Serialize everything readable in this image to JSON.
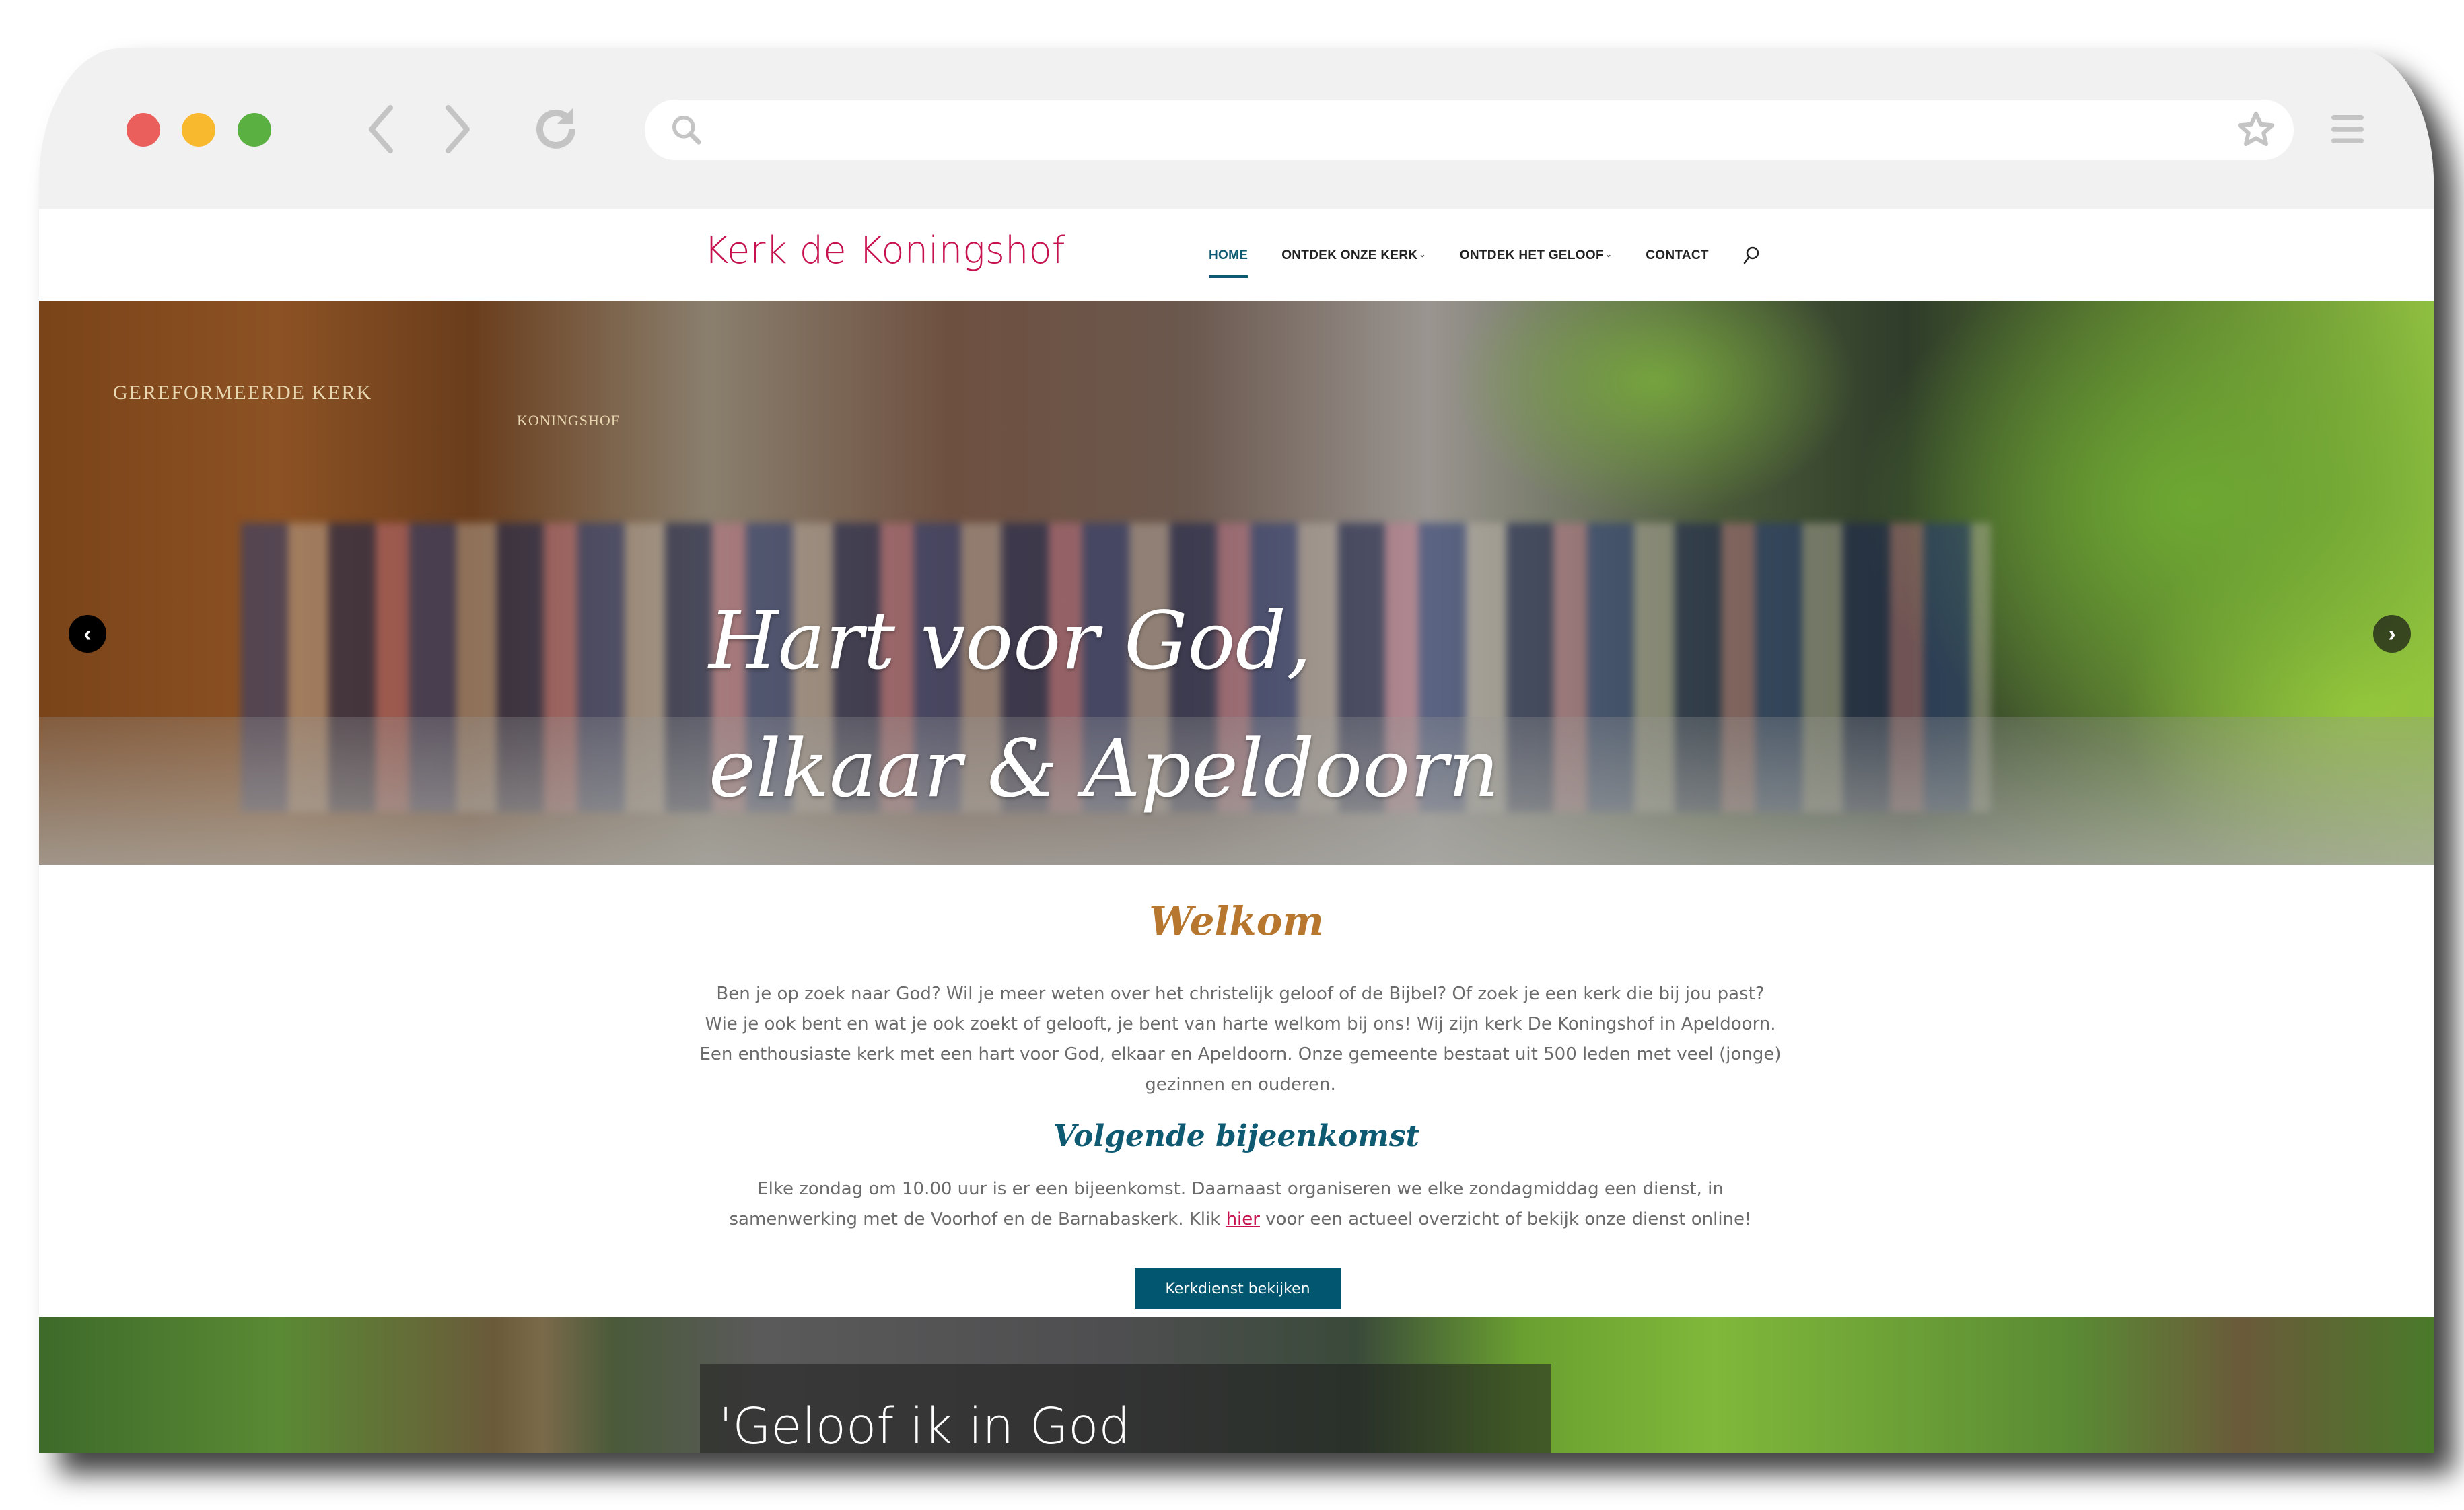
{
  "browser": {
    "address_value": "",
    "icons": [
      "close-dot",
      "minimize-dot",
      "maximize-dot",
      "back-icon",
      "forward-icon",
      "reload-icon",
      "search-icon",
      "star-icon",
      "menu-icon"
    ]
  },
  "site": {
    "logo": "Kerk de Koningshof",
    "brand_color": "#c8124f",
    "accent_color": "#0e5a73",
    "nav": [
      {
        "label": "HOME",
        "active": true,
        "dropdown": false
      },
      {
        "label": "ONTDEK ONZE KERK",
        "active": false,
        "dropdown": true
      },
      {
        "label": "ONTDEK HET GELOOF",
        "active": false,
        "dropdown": true
      },
      {
        "label": "CONTACT",
        "active": false,
        "dropdown": false
      }
    ],
    "dropdown_glyph": "⌄"
  },
  "hero": {
    "line1": "Hart voor God,",
    "line2": "elkaar & Apeldoorn",
    "sign1": "GEREFORMEERDE KERK",
    "sign2": "KONINGSHOF",
    "prev_glyph": "‹",
    "next_glyph": "›"
  },
  "welcome": {
    "title": "Welkom",
    "title_color": "#b8772f",
    "text": "Ben je op zoek naar God? Wil je meer weten over het christelijk geloof of de Bijbel? Of  zoek je een kerk die bij jou past? Wie je ook bent en wat je ook zoekt of gelooft, je bent van harte welkom bij ons! Wij zijn kerk De Koningshof in Apeldoorn. Een enthousiaste kerk met een hart voor God, elkaar en Apeldoorn. Onze gemeente bestaat uit 500 leden met veel (jonge) gezinnen en ouderen."
  },
  "next_meeting": {
    "title": "Volgende bijeenkomst",
    "text_before": "Elke zondag om 10.00 uur is er een bijeenkomst. Daarnaast organiseren we elke zondagmiddag een dienst, in samenwerking met de Voorhof en de Barnabaskerk. Klik ",
    "link": "hier",
    "text_after": " voor een actueel overzicht of bekijk onze dienst online!",
    "button": "Kerkdienst bekijken"
  },
  "banner": {
    "title": "'Geloof ik in God"
  }
}
